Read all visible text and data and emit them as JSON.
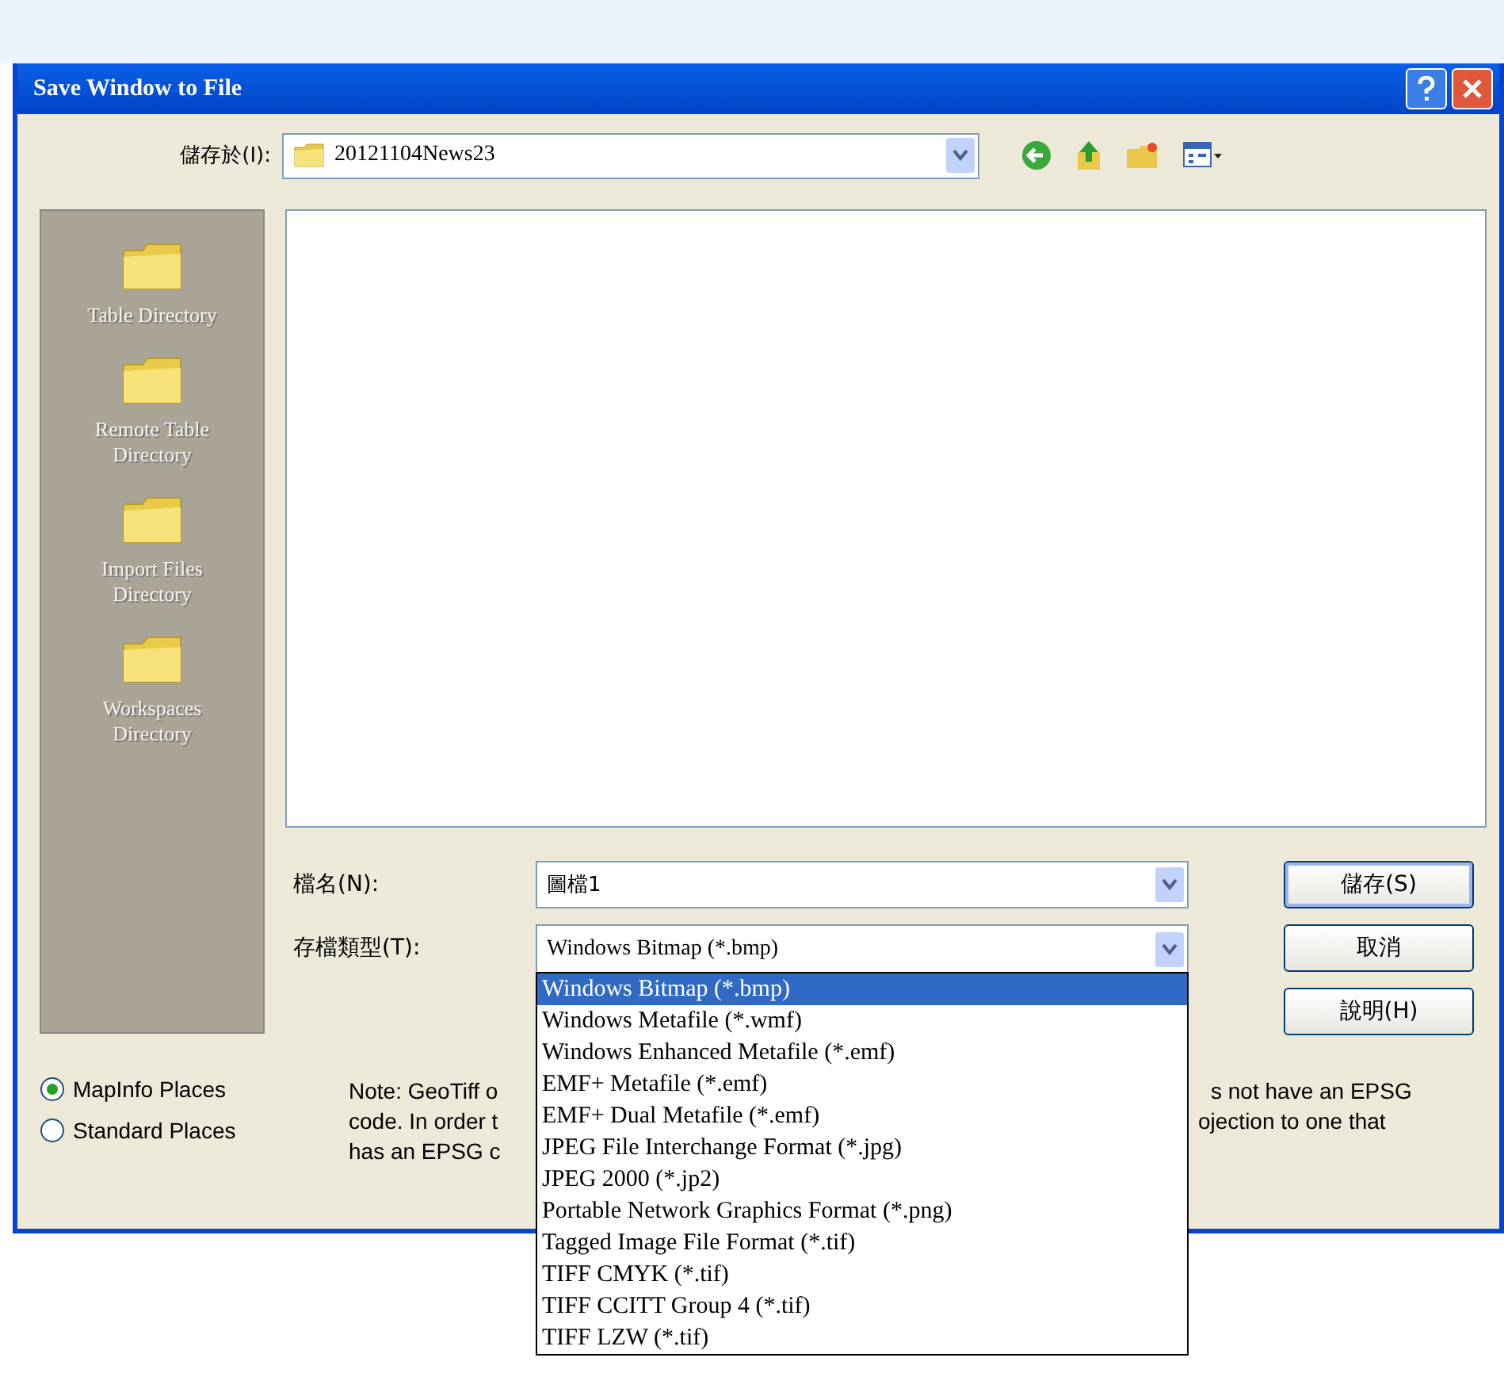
{
  "window": {
    "title": "Save Window to File"
  },
  "save_in": {
    "label": "儲存於(I):",
    "value": "20121104News23"
  },
  "places": [
    {
      "label": "Table Directory"
    },
    {
      "label": "Remote Table Directory"
    },
    {
      "label": "Import Files Directory"
    },
    {
      "label": "Workspaces Directory"
    }
  ],
  "file_name": {
    "label": "檔名(N):",
    "value": "圖檔1"
  },
  "file_type": {
    "label": "存檔類型(T):",
    "value": "Windows Bitmap (*.bmp)",
    "options": [
      {
        "label": "Windows Bitmap (*.bmp)",
        "selected": true
      },
      {
        "label": "Windows Metafile (*.wmf)",
        "selected": false
      },
      {
        "label": "Windows Enhanced Metafile (*.emf)",
        "selected": false
      },
      {
        "label": "EMF+ Metafile (*.emf)",
        "selected": false
      },
      {
        "label": "EMF+ Dual Metafile (*.emf)",
        "selected": false
      },
      {
        "label": "JPEG File Interchange Format (*.jpg)",
        "selected": false
      },
      {
        "label": "JPEG 2000 (*.jp2)",
        "selected": false
      },
      {
        "label": "Portable Network Graphics Format (*.png)",
        "selected": false
      },
      {
        "label": "Tagged Image File Format (*.tif)",
        "selected": false
      },
      {
        "label": "TIFF CMYK (*.tif)",
        "selected": false
      },
      {
        "label": "TIFF CCITT Group 4 (*.tif)",
        "selected": false
      },
      {
        "label": "TIFF LZW (*.tif)",
        "selected": false
      }
    ]
  },
  "buttons": [
    {
      "label": "儲存(S)",
      "default": true
    },
    {
      "label": "取消",
      "default": false
    },
    {
      "label": "說明(H)",
      "default": false
    }
  ],
  "place_sets": [
    {
      "label": "MapInfo Places",
      "selected": true
    },
    {
      "label": "Standard Places",
      "selected": false
    }
  ],
  "note": {
    "left_lines": [
      "Note: GeoTiff o",
      "code. In order t",
      "has an EPSG c"
    ],
    "right_lines": [
      "s not have an EPSG",
      "ojection to one that"
    ]
  }
}
